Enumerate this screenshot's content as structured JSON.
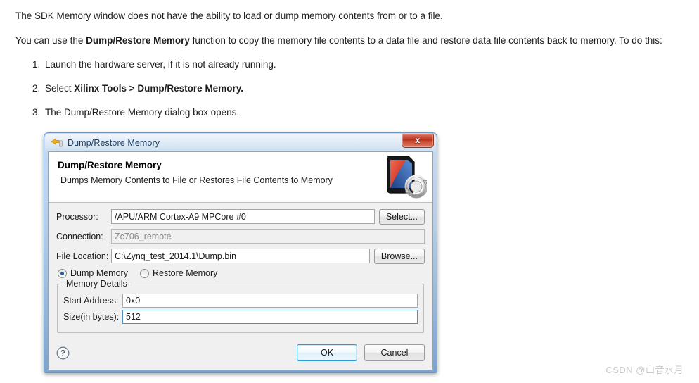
{
  "doc": {
    "paragraph1": "The SDK Memory window does not have the ability to load or dump memory contents from or to a file.",
    "paragraph2_pre": "You can use the ",
    "paragraph2_bold": "Dump/Restore Memory",
    "paragraph2_post": " function to copy the memory file contents to a data file and restore data file contents back to memory. To do this:",
    "steps": [
      {
        "num": "1.",
        "pre": "Launch the hardware server, if it is not already running.",
        "bold": "",
        "post": ""
      },
      {
        "num": "2.",
        "pre": "Select ",
        "bold": "Xilinx Tools > Dump/Restore Memory.",
        "post": ""
      },
      {
        "num": "3.",
        "pre": "The Dump/Restore Memory dialog box opens.",
        "bold": "",
        "post": ""
      }
    ]
  },
  "dialog": {
    "titlebar": {
      "title": "Dump/Restore Memory",
      "icon": "dump-restore-memory-icon",
      "close_label": "x"
    },
    "banner": {
      "title": "Dump/Restore Memory",
      "subtitle": "Dumps Memory Contents to File or Restores File Contents to Memory",
      "logo": "memory-card-sync-icon"
    },
    "form": {
      "processor_label": "Processor:",
      "processor_value": "/APU/ARM Cortex-A9 MPCore #0",
      "select_button": "Select...",
      "connection_label": "Connection:",
      "connection_value": "Zc706_remote",
      "file_location_label": "File Location:",
      "file_location_value": "C:\\Zynq_test_2014.1\\Dump.bin",
      "browse_button": "Browse...",
      "radio_dump": "Dump Memory",
      "radio_restore": "Restore Memory",
      "selected_mode": "Dump Memory"
    },
    "memory_details": {
      "group_title": "Memory Details",
      "start_address_label": "Start Address:",
      "start_address_value": "0x0",
      "size_label": "Size(in bytes):",
      "size_value": "512"
    },
    "buttons": {
      "help": "?",
      "ok": "OK",
      "cancel": "Cancel"
    }
  },
  "watermark": "CSDN @山音水月",
  "colors": {
    "titlebar_blue": "#b5cde6",
    "close_red": "#b32e18",
    "accent_blue": "#2e9ad6",
    "radio_fill": "#2a5d9c"
  }
}
